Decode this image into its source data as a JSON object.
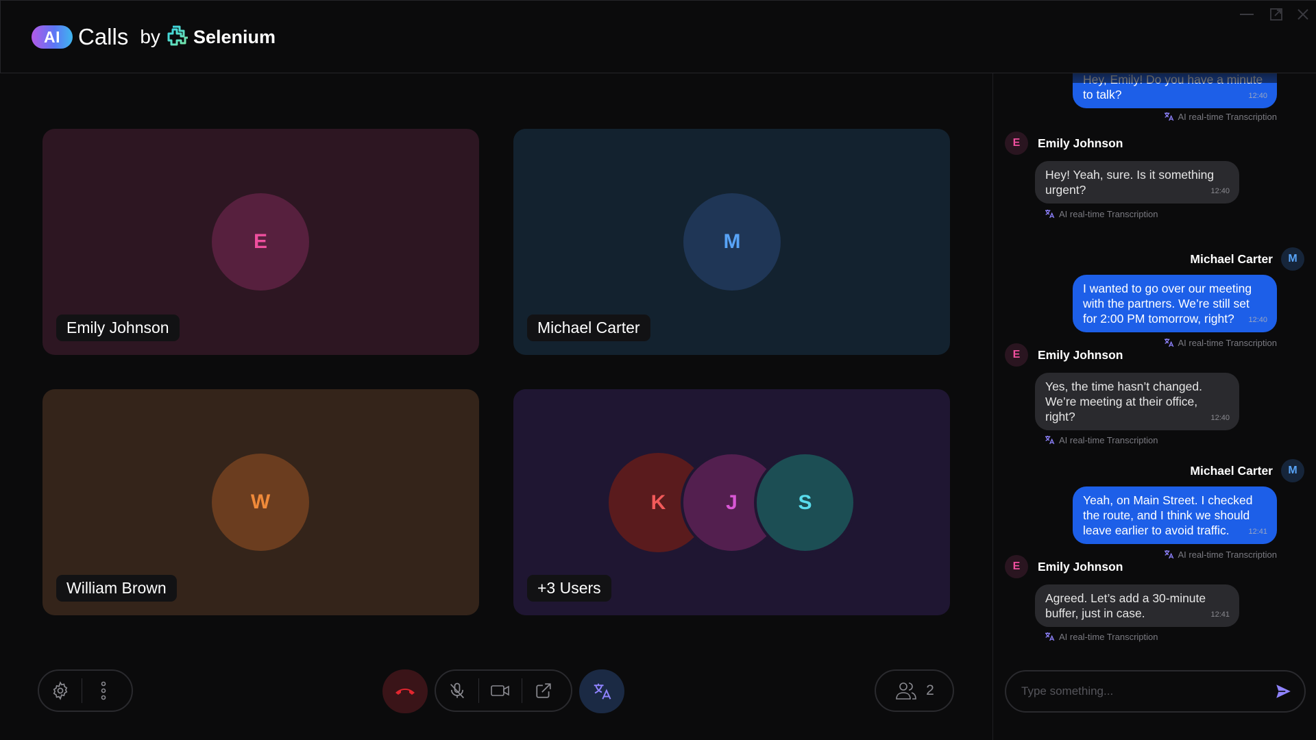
{
  "header": {
    "ai_badge": "AI",
    "app_name": "Calls",
    "by_text": "by",
    "brand_name": "Selenium"
  },
  "tiles": [
    {
      "initial": "E",
      "name": "Emily Johnson",
      "bg": "#2d1622",
      "circle": "#57203e",
      "letter": "#ef4f9e"
    },
    {
      "initial": "M",
      "name": "Michael Carter",
      "bg": "#13222f",
      "circle": "#1f3656",
      "letter": "#58a3f6"
    },
    {
      "initial": "W",
      "name": "William Brown",
      "bg": "#34241a",
      "circle": "#6b3d1f",
      "letter": "#f08a3a"
    },
    {
      "name": "+3 Users",
      "bg": "#1f1632",
      "group": [
        {
          "initial": "K",
          "circle": "#5a1b1d",
          "letter": "#f25a5a"
        },
        {
          "initial": "J",
          "circle": "#531f4f",
          "letter": "#d957d5"
        },
        {
          "initial": "S",
          "circle": "#1c4e54",
          "letter": "#59dded"
        }
      ]
    }
  ],
  "controls": {
    "participants_count": "2"
  },
  "chat": {
    "messages": [
      {
        "side": "right",
        "text": "Hey, Emily! Do you have a minute to talk?",
        "time": "12:40",
        "note": "AI real-time Transcription"
      },
      {
        "side": "left",
        "sender": "Emily Johnson",
        "initial": "E",
        "text": "Hey! Yeah, sure. Is it something urgent?",
        "time": "12:40",
        "note": "AI real-time Transcription"
      },
      {
        "side": "right",
        "sender": "Michael Carter",
        "initial": "M",
        "text": "I wanted to go over our meeting with the partners. We’re still set for 2:00 PM tomorrow, right?",
        "time": "12:40",
        "note": "AI real-time Transcription"
      },
      {
        "side": "left",
        "sender": "Emily Johnson",
        "initial": "E",
        "text": "Yes, the time hasn’t changed. We’re meeting at their office, right?",
        "time": "12:40",
        "note": "AI real-time Transcription"
      },
      {
        "side": "right",
        "sender": "Michael Carter",
        "initial": "M",
        "text": "Yeah, on Main Street. I checked the route, and I think we should leave earlier to avoid traffic.",
        "time": "12:41",
        "note": "AI real-time Transcription"
      },
      {
        "side": "left",
        "sender": "Emily Johnson",
        "initial": "E",
        "text": "Agreed. Let’s add a 30-minute buffer, just in case.",
        "time": "12:41",
        "note": "AI real-time Transcription"
      }
    ],
    "input_placeholder": "Type something..."
  },
  "colors": {
    "accent_blue": "#1d5fe8",
    "end_call_red": "#e3262f",
    "translate_accent": "#8f83ff"
  }
}
